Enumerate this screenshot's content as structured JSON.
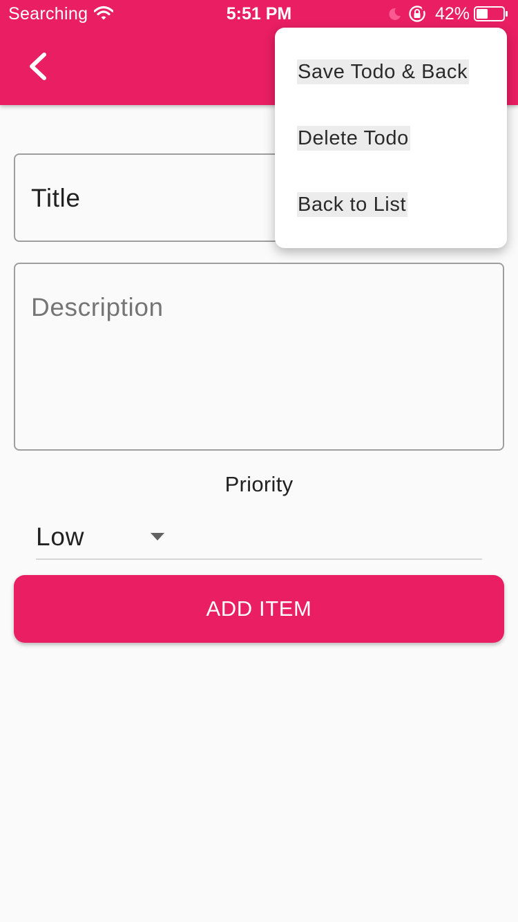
{
  "status_bar": {
    "carrier": "Searching",
    "time": "5:51 PM",
    "battery_percent": "42%"
  },
  "app_bar": {
    "back_icon": "chevron-left-icon"
  },
  "form": {
    "title_value": "Title",
    "description_placeholder": "Description",
    "priority_label": "Priority",
    "priority_value": "Low",
    "add_button_label": "ADD ITEM"
  },
  "menu": {
    "items": [
      {
        "label": "Save Todo & Back"
      },
      {
        "label": "Delete Todo"
      },
      {
        "label": "Back to List"
      }
    ]
  },
  "colors": {
    "accent": "#e91e63",
    "background": "#fafafa",
    "field_border": "#9e9e9e"
  }
}
